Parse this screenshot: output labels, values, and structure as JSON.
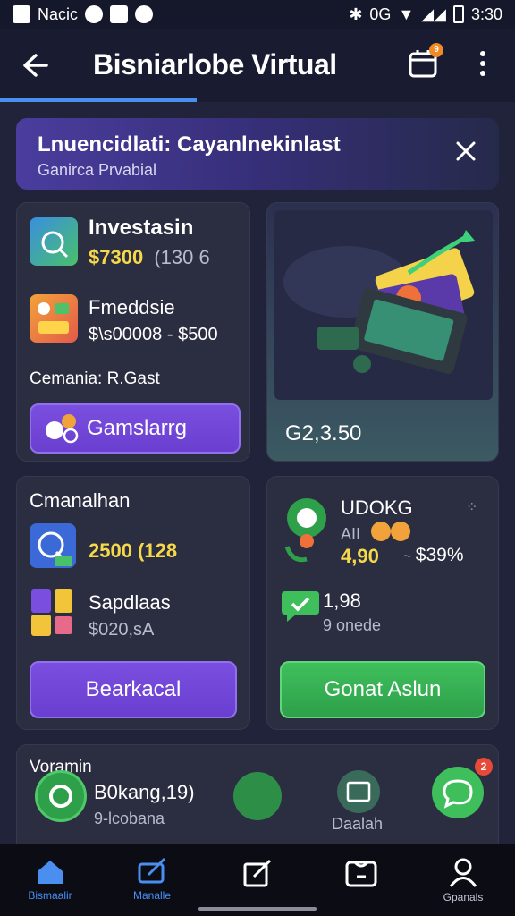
{
  "status_bar": {
    "left_label": "Nacic",
    "network": "0G",
    "time": "3:30"
  },
  "header": {
    "title": "Bisniarlobe Virtual",
    "notification_count": "9"
  },
  "banner": {
    "title": "Lnuencidlati: Cayanlnekinlast",
    "subtitle": "Ganirca Prvabial"
  },
  "invest_card": {
    "row1_title": "Investasin",
    "row1_value": "$7300",
    "row1_extra": "(130 6",
    "row2_title": "Fmeddsie",
    "row2_value": "$\\s00008 - $500",
    "footer_label": "Cemania: R.Gast",
    "button_label": "Gamslarrg"
  },
  "image_card": {
    "value": "G2,3.50"
  },
  "comm_card": {
    "title": "Cmanalhan",
    "row1_value": "2500 (128",
    "row2_title": "Sapdlaas",
    "row2_value": "$020,sA",
    "button_label": "Bearkacal"
  },
  "stats_card": {
    "row1_title": "UDOKG",
    "row1_prefix": "AII",
    "row1_value": "4,90",
    "row1_delta": "$39%",
    "row2_value": "1,98",
    "row2_sub": "9 onede",
    "button_label": "Gonat Aslun"
  },
  "bottom_card": {
    "title": "Voramin",
    "item_value": "B0kang,19)",
    "item_sub": "9-lcobana",
    "item3_label": "Daalah",
    "badge_count": "2"
  },
  "bottom_nav": {
    "items": [
      {
        "label": "Bismaalir"
      },
      {
        "label": "Manalle"
      },
      {
        "label": ""
      },
      {
        "label": ""
      },
      {
        "label": "Gpanals"
      }
    ]
  }
}
